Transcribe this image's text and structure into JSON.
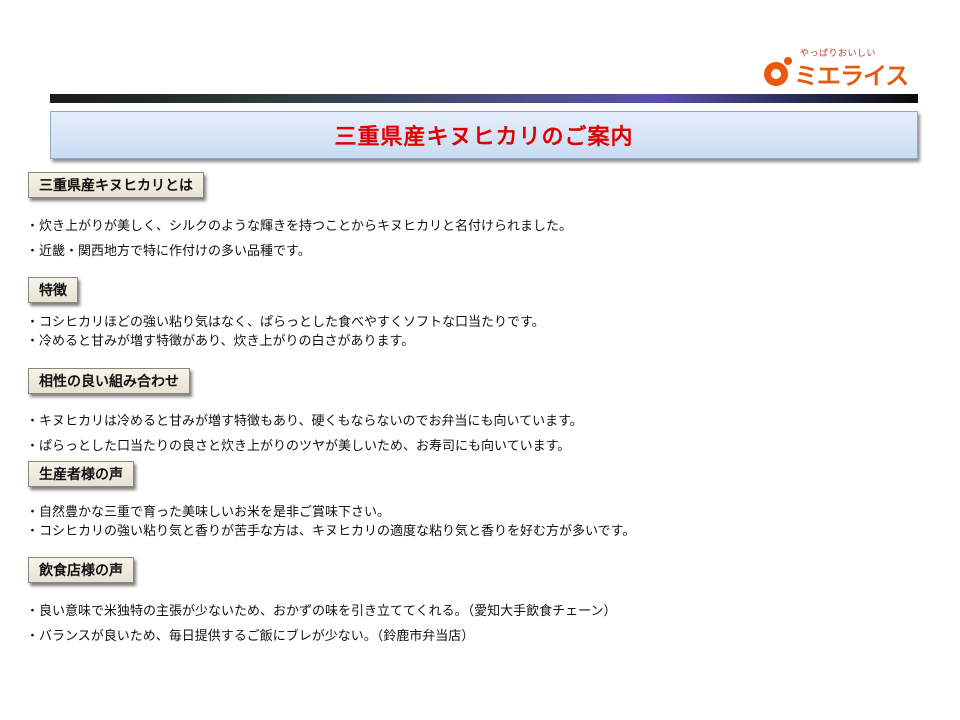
{
  "logo": {
    "tagline": "やっぱりおいしい",
    "name": "ミエライス"
  },
  "title": "三重県産キヌヒカリのご案内",
  "sections": [
    {
      "heading": "三重県産キヌヒカリとは",
      "items": [
        "・炊き上がりが美しく、シルクのような輝きを持つことからキヌヒカリと名付けられました。",
        "・近畿・関西地方で特に作付けの多い品種です。"
      ]
    },
    {
      "heading": "特徴",
      "items": [
        "・コシヒカリほどの強い粘り気はなく、ぱらっとした食べやすくソフトな口当たりです。",
        "・冷めると甘みが増す特徴があり、炊き上がりの白さがあります。"
      ]
    },
    {
      "heading": "相性の良い組み合わせ",
      "items": [
        "・キヌヒカリは冷めると甘みが増す特徴もあり、硬くもならないのでお弁当にも向いています。",
        "・ぱらっとした口当たりの良さと炊き上がりのツヤが美しいため、お寿司にも向いています。"
      ]
    },
    {
      "heading": "生産者様の声",
      "items": [
        "・自然豊かな三重で育った美味しいお米を是非ご賞味下さい。",
        "・コシヒカリの強い粘り気と香りが苦手な方は、キヌヒカリの適度な粘り気と香りを好む方が多いです。"
      ]
    },
    {
      "heading": "飲食店様の声",
      "items": [
        "・良い意味で米独特の主張が少ないため、おかずの味を引き立ててくれる。（愛知大手飲食チェーン）",
        "・バランスが良いため、毎日提供するご飯にブレが少ない。（鈴鹿市弁当店）"
      ]
    }
  ]
}
